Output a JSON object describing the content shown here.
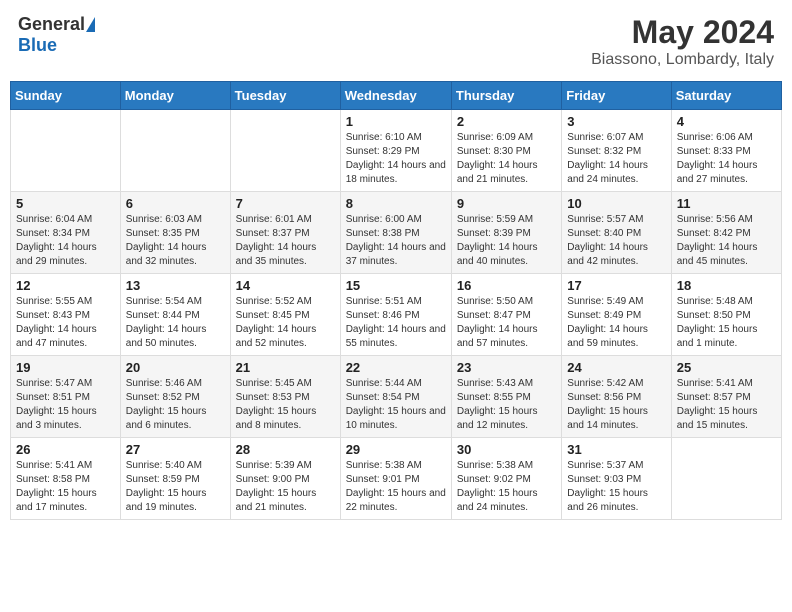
{
  "logo": {
    "general": "General",
    "blue": "Blue"
  },
  "header": {
    "month": "May 2024",
    "location": "Biassono, Lombardy, Italy"
  },
  "weekdays": [
    "Sunday",
    "Monday",
    "Tuesday",
    "Wednesday",
    "Thursday",
    "Friday",
    "Saturday"
  ],
  "weeks": [
    [
      {
        "day": "",
        "info": ""
      },
      {
        "day": "",
        "info": ""
      },
      {
        "day": "",
        "info": ""
      },
      {
        "day": "1",
        "info": "Sunrise: 6:10 AM\nSunset: 8:29 PM\nDaylight: 14 hours and 18 minutes."
      },
      {
        "day": "2",
        "info": "Sunrise: 6:09 AM\nSunset: 8:30 PM\nDaylight: 14 hours and 21 minutes."
      },
      {
        "day": "3",
        "info": "Sunrise: 6:07 AM\nSunset: 8:32 PM\nDaylight: 14 hours and 24 minutes."
      },
      {
        "day": "4",
        "info": "Sunrise: 6:06 AM\nSunset: 8:33 PM\nDaylight: 14 hours and 27 minutes."
      }
    ],
    [
      {
        "day": "5",
        "info": "Sunrise: 6:04 AM\nSunset: 8:34 PM\nDaylight: 14 hours and 29 minutes."
      },
      {
        "day": "6",
        "info": "Sunrise: 6:03 AM\nSunset: 8:35 PM\nDaylight: 14 hours and 32 minutes."
      },
      {
        "day": "7",
        "info": "Sunrise: 6:01 AM\nSunset: 8:37 PM\nDaylight: 14 hours and 35 minutes."
      },
      {
        "day": "8",
        "info": "Sunrise: 6:00 AM\nSunset: 8:38 PM\nDaylight: 14 hours and 37 minutes."
      },
      {
        "day": "9",
        "info": "Sunrise: 5:59 AM\nSunset: 8:39 PM\nDaylight: 14 hours and 40 minutes."
      },
      {
        "day": "10",
        "info": "Sunrise: 5:57 AM\nSunset: 8:40 PM\nDaylight: 14 hours and 42 minutes."
      },
      {
        "day": "11",
        "info": "Sunrise: 5:56 AM\nSunset: 8:42 PM\nDaylight: 14 hours and 45 minutes."
      }
    ],
    [
      {
        "day": "12",
        "info": "Sunrise: 5:55 AM\nSunset: 8:43 PM\nDaylight: 14 hours and 47 minutes."
      },
      {
        "day": "13",
        "info": "Sunrise: 5:54 AM\nSunset: 8:44 PM\nDaylight: 14 hours and 50 minutes."
      },
      {
        "day": "14",
        "info": "Sunrise: 5:52 AM\nSunset: 8:45 PM\nDaylight: 14 hours and 52 minutes."
      },
      {
        "day": "15",
        "info": "Sunrise: 5:51 AM\nSunset: 8:46 PM\nDaylight: 14 hours and 55 minutes."
      },
      {
        "day": "16",
        "info": "Sunrise: 5:50 AM\nSunset: 8:47 PM\nDaylight: 14 hours and 57 minutes."
      },
      {
        "day": "17",
        "info": "Sunrise: 5:49 AM\nSunset: 8:49 PM\nDaylight: 14 hours and 59 minutes."
      },
      {
        "day": "18",
        "info": "Sunrise: 5:48 AM\nSunset: 8:50 PM\nDaylight: 15 hours and 1 minute."
      }
    ],
    [
      {
        "day": "19",
        "info": "Sunrise: 5:47 AM\nSunset: 8:51 PM\nDaylight: 15 hours and 3 minutes."
      },
      {
        "day": "20",
        "info": "Sunrise: 5:46 AM\nSunset: 8:52 PM\nDaylight: 15 hours and 6 minutes."
      },
      {
        "day": "21",
        "info": "Sunrise: 5:45 AM\nSunset: 8:53 PM\nDaylight: 15 hours and 8 minutes."
      },
      {
        "day": "22",
        "info": "Sunrise: 5:44 AM\nSunset: 8:54 PM\nDaylight: 15 hours and 10 minutes."
      },
      {
        "day": "23",
        "info": "Sunrise: 5:43 AM\nSunset: 8:55 PM\nDaylight: 15 hours and 12 minutes."
      },
      {
        "day": "24",
        "info": "Sunrise: 5:42 AM\nSunset: 8:56 PM\nDaylight: 15 hours and 14 minutes."
      },
      {
        "day": "25",
        "info": "Sunrise: 5:41 AM\nSunset: 8:57 PM\nDaylight: 15 hours and 15 minutes."
      }
    ],
    [
      {
        "day": "26",
        "info": "Sunrise: 5:41 AM\nSunset: 8:58 PM\nDaylight: 15 hours and 17 minutes."
      },
      {
        "day": "27",
        "info": "Sunrise: 5:40 AM\nSunset: 8:59 PM\nDaylight: 15 hours and 19 minutes."
      },
      {
        "day": "28",
        "info": "Sunrise: 5:39 AM\nSunset: 9:00 PM\nDaylight: 15 hours and 21 minutes."
      },
      {
        "day": "29",
        "info": "Sunrise: 5:38 AM\nSunset: 9:01 PM\nDaylight: 15 hours and 22 minutes."
      },
      {
        "day": "30",
        "info": "Sunrise: 5:38 AM\nSunset: 9:02 PM\nDaylight: 15 hours and 24 minutes."
      },
      {
        "day": "31",
        "info": "Sunrise: 5:37 AM\nSunset: 9:03 PM\nDaylight: 15 hours and 26 minutes."
      },
      {
        "day": "",
        "info": ""
      }
    ]
  ]
}
